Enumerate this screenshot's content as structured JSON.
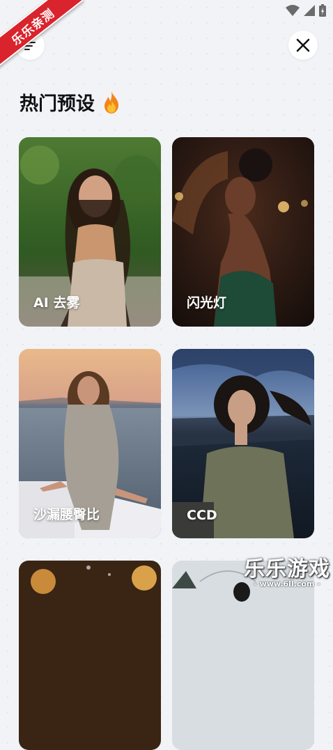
{
  "badge": {
    "text": "乐乐亲测"
  },
  "header": {
    "section_title": "热门预设"
  },
  "cards": [
    {
      "label": "AI 去雾"
    },
    {
      "label": "闪光灯"
    },
    {
      "label": "沙漏腰臀比"
    },
    {
      "label": "CCD"
    }
  ],
  "watermark": {
    "title": "乐乐游戏",
    "url": "- www.6ll.com -"
  }
}
